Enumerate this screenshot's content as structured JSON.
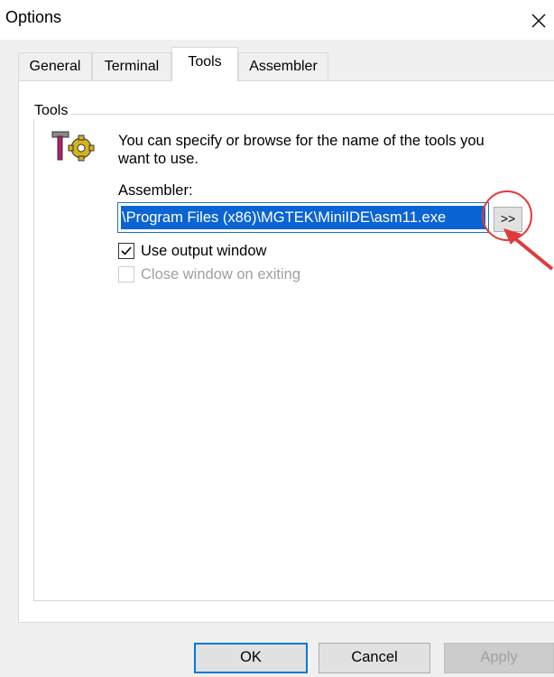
{
  "window": {
    "title": "Options"
  },
  "tabs": [
    {
      "label": "General"
    },
    {
      "label": "Terminal"
    },
    {
      "label": "Tools",
      "active": true
    },
    {
      "label": "Assembler"
    }
  ],
  "tools": {
    "group_label": "Tools",
    "description": "You can specify or browse for the name of the tools you want to use.",
    "assembler_label": "Assembler:",
    "assembler_path": "\\Program Files (x86)\\MGTEK\\MiniIDE\\asm11.exe",
    "browse_label": ">>",
    "use_output_window": {
      "label": "Use output window",
      "checked": true
    },
    "close_window_on_exiting": {
      "label": "Close window on exiting",
      "checked": false,
      "enabled": false
    }
  },
  "buttons": {
    "ok": "OK",
    "cancel": "Cancel",
    "apply": "Apply"
  },
  "icons": {
    "close": "close-icon",
    "tools": "tools-icon",
    "annotation": "red-arrow-icon"
  },
  "colors": {
    "selection": "#0b64d4",
    "focus_border": "#0078d7",
    "annotation": "#e03a3a"
  }
}
